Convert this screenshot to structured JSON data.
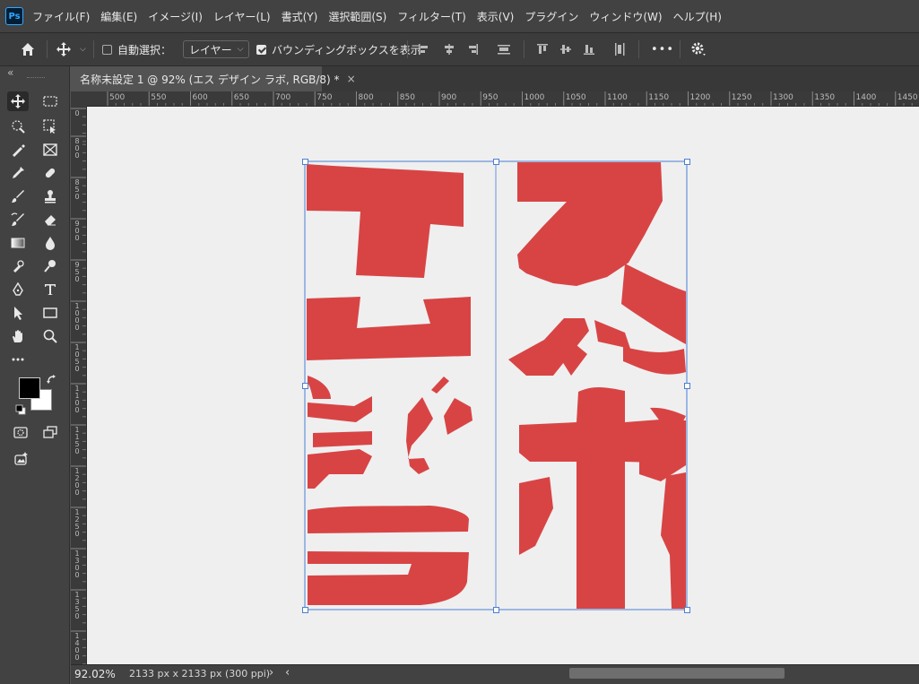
{
  "menu": {
    "items": [
      "ファイル(F)",
      "編集(E)",
      "イメージ(I)",
      "レイヤー(L)",
      "書式(Y)",
      "選択範囲(S)",
      "フィルター(T)",
      "表示(V)",
      "プラグイン",
      "ウィンドウ(W)",
      "ヘルプ(H)"
    ],
    "logo_text": "Ps"
  },
  "options": {
    "auto_select_label": "自動選択：",
    "auto_select_checked": false,
    "target_value": "レイヤー",
    "bounding_box_label": "バウンディングボックスを表示",
    "bounding_box_checked": true,
    "more_label": "•••"
  },
  "toolbar": {
    "collapse_label": "«"
  },
  "document": {
    "tab_title": "名称未設定 1 @ 92% (エス デザイン ラボ, RGB/8) *",
    "close_label": "×"
  },
  "rulers": {
    "top_ticks": [
      "500",
      "550",
      "600",
      "650",
      "700",
      "750",
      "800",
      "850",
      "900",
      "950",
      "1000",
      "1050",
      "1100",
      "1150",
      "1200",
      "1250",
      "1300",
      "1350",
      "1400",
      "1450"
    ],
    "left_ticks": [
      "0",
      "800",
      "850",
      "900",
      "950",
      "1000",
      "1050",
      "1100",
      "1150",
      "1200",
      "1250",
      "1300",
      "1350",
      "1400"
    ]
  },
  "status": {
    "zoom": "92.02%",
    "doc_info": "2133 px x 2133 px (300 ppi)",
    "arrow_right": "›",
    "arrow_left": "‹"
  },
  "artwork": {
    "text_color": "#d84444",
    "left_column": "エスデザ",
    "right_column": "スイン ラボ",
    "layer_name": "エス デザイン ラボ"
  },
  "colors": {
    "foreground": "#000000",
    "background": "#ffffff",
    "selection": "#4a7fd4"
  }
}
